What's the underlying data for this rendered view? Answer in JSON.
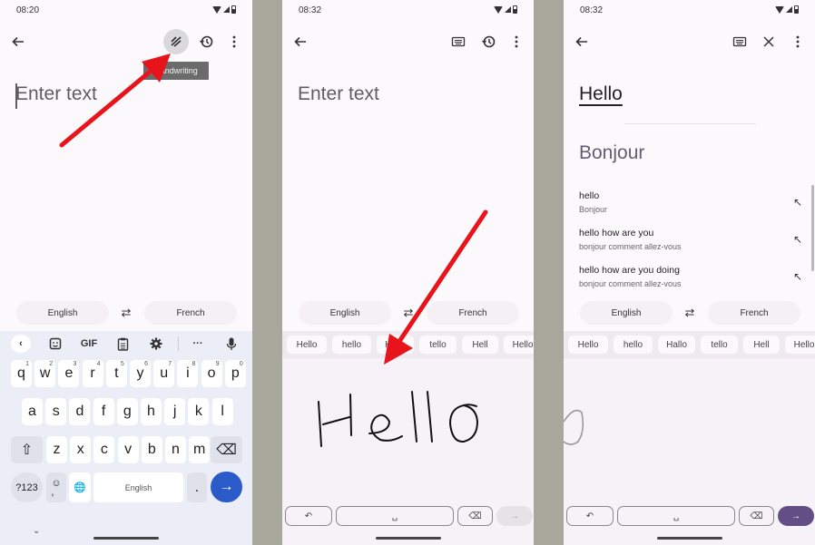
{
  "panels": [
    {
      "status": {
        "time": "08:20"
      },
      "toolbar": {
        "back": "back-arrow",
        "handwriting": "handwriting-icon",
        "history": "history-icon",
        "more": "more-vert-icon"
      },
      "tooltip": "Handwriting",
      "input": {
        "placeholder": "Enter text"
      },
      "languages": {
        "source": "English",
        "target": "French",
        "swap": "⇄"
      },
      "keyboard": {
        "tools": {
          "back": "‹",
          "sticker": "sticker-icon",
          "gif": "GIF",
          "clipboard": "clipboard-icon",
          "settings": "gear-icon",
          "more": "···",
          "mic": "mic-icon"
        },
        "row1": [
          {
            "k": "q",
            "n": "1"
          },
          {
            "k": "w",
            "n": "2"
          },
          {
            "k": "e",
            "n": "3"
          },
          {
            "k": "r",
            "n": "4"
          },
          {
            "k": "t",
            "n": "5"
          },
          {
            "k": "y",
            "n": "6"
          },
          {
            "k": "u",
            "n": "7"
          },
          {
            "k": "i",
            "n": "8"
          },
          {
            "k": "o",
            "n": "9"
          },
          {
            "k": "p",
            "n": "0"
          }
        ],
        "row2": [
          "a",
          "s",
          "d",
          "f",
          "g",
          "h",
          "j",
          "k",
          "l"
        ],
        "row3": [
          "z",
          "x",
          "c",
          "v",
          "b",
          "n",
          "m"
        ],
        "shift": "⇧",
        "backspace": "⌫",
        "symbols": "?123",
        "emoji_comma": "☺\n,",
        "globe": "🌐",
        "space": "English",
        "period": ".",
        "enter": "→",
        "collapse": "⌄"
      }
    },
    {
      "status": {
        "time": "08:32"
      },
      "toolbar": {
        "back": "back-arrow",
        "keyboard": "keyboard-icon",
        "history": "history-icon",
        "more": "more-vert-icon"
      },
      "input": {
        "placeholder": "Enter text"
      },
      "languages": {
        "source": "English",
        "target": "French",
        "swap": "⇄"
      },
      "suggestions": [
        "Hello",
        "hello",
        "Hallo",
        "tello",
        "Hell",
        "Hello"
      ],
      "handwriting_text": "Hello",
      "controls": {
        "undo": "↶",
        "space": "␣",
        "delete": "⌫",
        "go": "→"
      }
    },
    {
      "status": {
        "time": "08:32"
      },
      "toolbar": {
        "back": "back-arrow",
        "keyboard": "keyboard-icon",
        "clear": "close-icon",
        "more": "more-vert-icon"
      },
      "source_text": "Hello",
      "translation": "Bonjour",
      "results": [
        {
          "source": "hello",
          "target": "Bonjour"
        },
        {
          "source": "hello how are you",
          "target": "bonjour comment allez-vous"
        },
        {
          "source": "hello how are you doing",
          "target": "bonjour comment allez-vous"
        }
      ],
      "languages": {
        "source": "English",
        "target": "French",
        "swap": "⇄"
      },
      "suggestions": [
        "Hello",
        "hello",
        "Hallo",
        "tello",
        "Hell",
        "Hello"
      ],
      "controls": {
        "undo": "↶",
        "space": "␣",
        "delete": "⌫",
        "go": "→"
      }
    }
  ],
  "colors": {
    "annotation_arrow": "#e8141b",
    "enter_key": "#2a5bc8",
    "go_active": "#634e86",
    "translation_text": "#655c74"
  }
}
